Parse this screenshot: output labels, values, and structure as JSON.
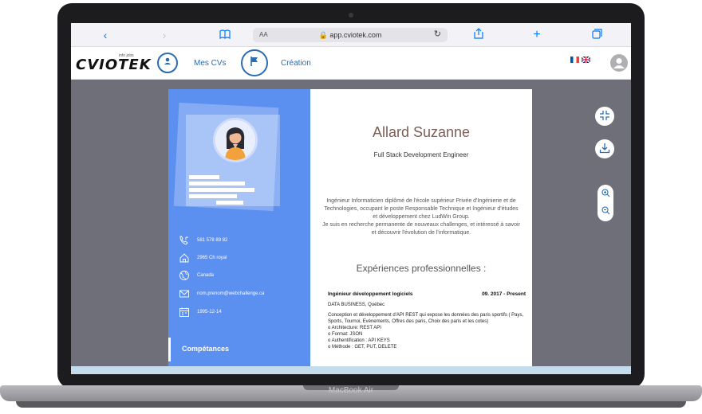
{
  "browser": {
    "text_size_label": "AA",
    "url": "app.cviotek.com"
  },
  "app": {
    "logo_text": "CVIOTEK",
    "logo_tagline": "info jobs",
    "nav": [
      {
        "label": "Mes CVs",
        "icon": "user-icon"
      },
      {
        "label": "Création",
        "icon": "flag-icon"
      }
    ],
    "languages": [
      "fr",
      "en"
    ]
  },
  "cv": {
    "name": "Allard Suzanne",
    "role": "Full Stack Development Engineer",
    "summary": "Ingénieur Informaticien diplômé de l'école supérieur Privée d'Ingénierie et de Technologies, occupant le poste Responsable Technique et Ingénieur d'études et développement chez LudWin Group.\nJe suis en recherche permanente de nouveaux challenges, et intéressé à savoir et découvrir l'évolution de l'informatique.",
    "contacts": [
      {
        "icon": "phone-icon",
        "value": "581 578 89 82"
      },
      {
        "icon": "home-icon",
        "value": "2965 Ch royal"
      },
      {
        "icon": "globe-icon",
        "value": "Canada"
      },
      {
        "icon": "mail-icon",
        "value": "nom.prenom@webchallenge.ca"
      },
      {
        "icon": "calendar-icon",
        "value": "1995-12-14"
      }
    ],
    "skills_label": "Compétances",
    "experience_heading": "Expériences professionnelles :",
    "jobs": [
      {
        "title": "Ingénieur développement logiciels",
        "date": "09. 2017 - Present",
        "company": "DATA BUSINESS, Québec",
        "description": [
          "Conception et développement d'API REST qui expose les données des paris sportifs ( Pays, Sports, Tournoi, Evénements, Offres des paris, Choix des paris et les cotes)",
          "o Architecture: REST API",
          "o Format: JSON",
          "o Authentification : API KEYS",
          "o Méthode : GET, PUT, DELETE"
        ]
      }
    ]
  },
  "device": {
    "label": "MacBook Air"
  },
  "colors": {
    "accent": "#2b6cb0",
    "cv_sidebar": "#5b8ff0",
    "workspace": "#6f6f79",
    "name": "#7b5e57"
  }
}
